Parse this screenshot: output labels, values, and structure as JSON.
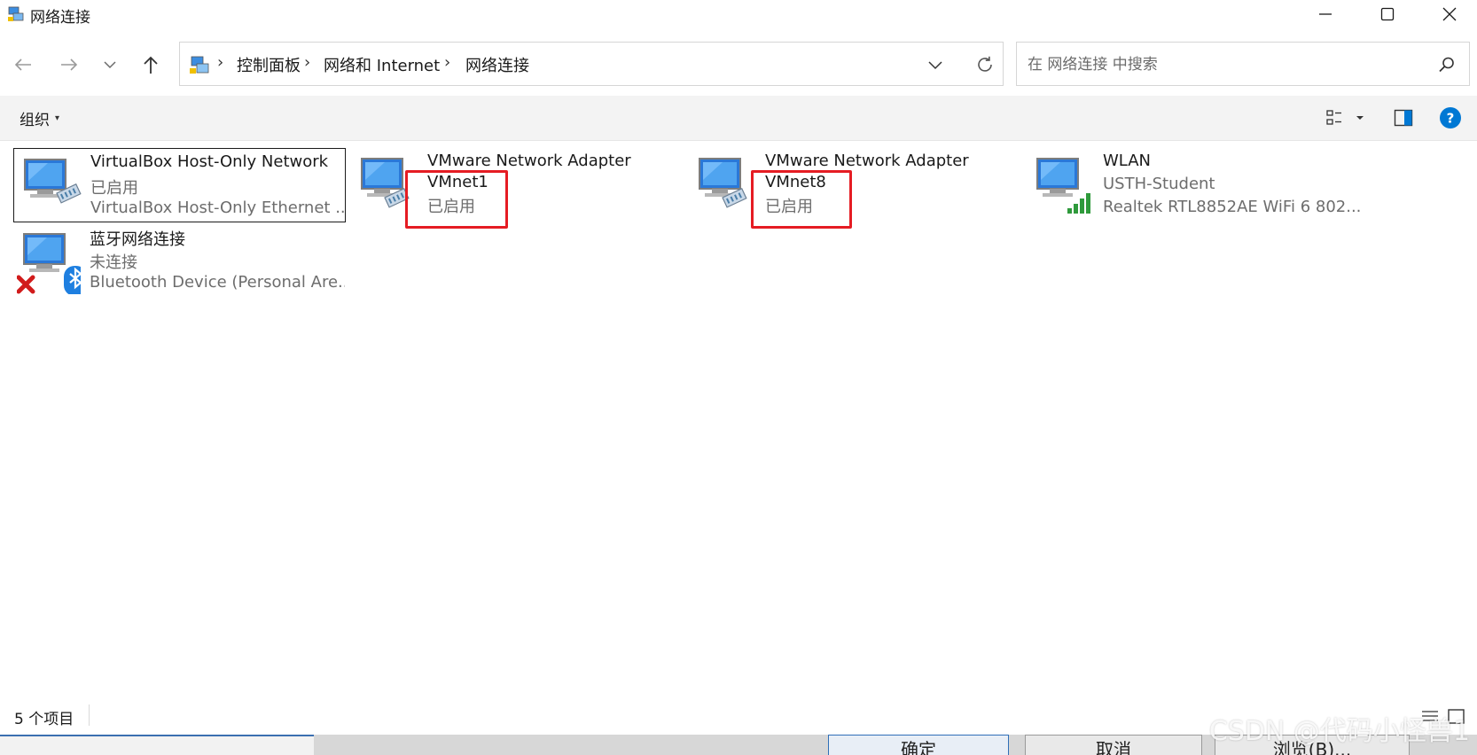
{
  "window": {
    "title": "网络连接",
    "icon": "network-connections-icon"
  },
  "address": {
    "crumbs": [
      "控制面板",
      "网络和 Internet",
      "网络连接"
    ],
    "separator": "›"
  },
  "search": {
    "placeholder": "在 网络连接 中搜索"
  },
  "toolbar": {
    "organize_label": "组织",
    "organize_caret": "▾"
  },
  "connections": [
    {
      "name": "VirtualBox Host-Only Network",
      "status": "已启用",
      "device": "VirtualBox Host-Only Ethernet ...",
      "icon": "ethernet-adapter-icon"
    },
    {
      "name": "VMware Network Adapter",
      "name2": "VMnet1",
      "status": "已启用",
      "icon": "ethernet-adapter-icon"
    },
    {
      "name": "VMware Network Adapter",
      "name2": "VMnet8",
      "status": "已启用",
      "icon": "ethernet-adapter-icon"
    },
    {
      "name": "WLAN",
      "status": "USTH-Student",
      "device": "Realtek RTL8852AE WiFi 6 802....",
      "icon": "wifi-adapter-icon"
    },
    {
      "name": "蓝牙网络连接",
      "status": "未连接",
      "device": "Bluetooth Device (Personal Are...",
      "icon": "bluetooth-adapter-icon"
    }
  ],
  "status_bar": {
    "count": "5 个项目"
  },
  "background_dialog": {
    "buttons": [
      "确定",
      "取消",
      "浏览(B)..."
    ]
  },
  "watermark": "CSDN @代码小怪兽1",
  "colors": {
    "highlight": "#e51c23",
    "accent": "#0078d4",
    "toolbar_bg": "#f3f3f3"
  }
}
